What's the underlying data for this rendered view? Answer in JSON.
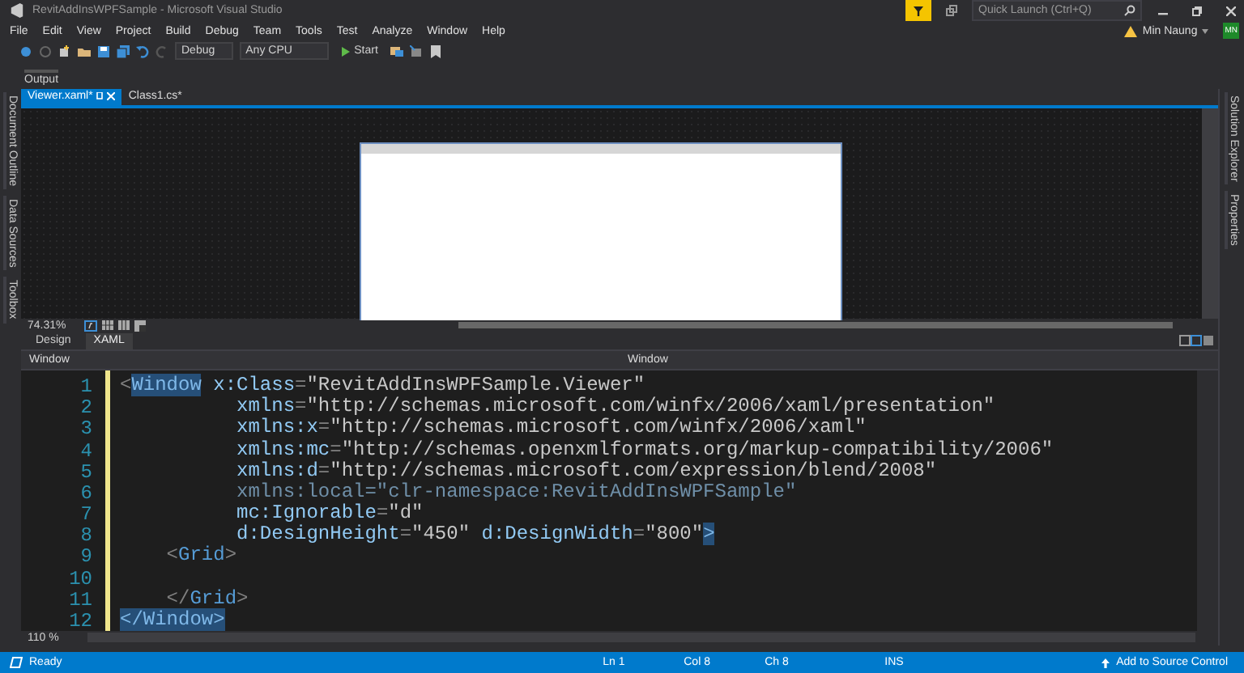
{
  "title_bar": {
    "title": "RevitAddInsWPFSample - Microsoft Visual Studio",
    "quick_launch": {
      "placeholder": "Quick Launch (Ctrl+Q)"
    },
    "user": {
      "name": "Min Naung",
      "initials": "MN"
    }
  },
  "menu": [
    "File",
    "Edit",
    "View",
    "Project",
    "Build",
    "Debug",
    "Team",
    "Tools",
    "Test",
    "Analyze",
    "Window",
    "Help"
  ],
  "toolbar": {
    "configuration": "Debug",
    "platform": "Any CPU",
    "start": "Start"
  },
  "output_panel": {
    "label": "Output"
  },
  "left_tabs": [
    "Document Outline",
    "Data Sources",
    "Toolbox"
  ],
  "right_tabs": [
    "Solution Explorer",
    "Properties"
  ],
  "document_tabs": [
    {
      "label": "Viewer.xaml*",
      "selected": true
    },
    {
      "label": "Class1.cs*",
      "selected": false
    }
  ],
  "designer": {
    "zoom": "74.31%"
  },
  "view_tabs": [
    {
      "label": "Design",
      "selected": false
    },
    {
      "label": "XAML",
      "selected": true
    }
  ],
  "breadcrumbs": [
    "Window",
    "Window"
  ],
  "code": [
    {
      "number": "1",
      "tokens": [
        {
          "t": "<",
          "kind": "punct",
          "highlighted": false
        },
        {
          "t": "Window",
          "kind": "tag",
          "highlighted": true
        },
        {
          "t": " x:Class",
          "kind": "attr",
          "highlighted": false
        },
        {
          "t": "=",
          "kind": "punct",
          "highlighted": false
        },
        {
          "t": "\"RevitAddInsWPFSample.Viewer\"",
          "kind": "value",
          "highlighted": false
        }
      ]
    },
    {
      "number": "2",
      "tokens": [
        {
          "t": "          xmlns",
          "kind": "attr",
          "highlighted": false
        },
        {
          "t": "=",
          "kind": "punct",
          "highlighted": false
        },
        {
          "t": "\"http://schemas.microsoft.com/winfx/2006/xaml/presentation\"",
          "kind": "value",
          "highlighted": false
        }
      ]
    },
    {
      "number": "3",
      "tokens": [
        {
          "t": "          xmlns:x",
          "kind": "attr",
          "highlighted": false
        },
        {
          "t": "=",
          "kind": "punct",
          "highlighted": false
        },
        {
          "t": "\"http://schemas.microsoft.com/winfx/2006/xaml\"",
          "kind": "value",
          "highlighted": false
        }
      ]
    },
    {
      "number": "4",
      "tokens": [
        {
          "t": "          xmlns:mc",
          "kind": "attr",
          "highlighted": false
        },
        {
          "t": "=",
          "kind": "punct",
          "highlighted": false
        },
        {
          "t": "\"http://schemas.openxmlformats.org/markup-compatibility/2006\"",
          "kind": "value",
          "highlighted": false
        }
      ]
    },
    {
      "number": "5",
      "tokens": [
        {
          "t": "          xmlns:d",
          "kind": "attr",
          "highlighted": false
        },
        {
          "t": "=",
          "kind": "punct",
          "highlighted": false
        },
        {
          "t": "\"http://schemas.microsoft.com/expression/blend/2008\"",
          "kind": "value",
          "highlighted": false
        }
      ]
    },
    {
      "number": "6",
      "tokens": [
        {
          "t": "          xmlns:local=\"clr-namespace:RevitAddInsWPFSample\"",
          "kind": "dim",
          "highlighted": false
        }
      ]
    },
    {
      "number": "7",
      "tokens": [
        {
          "t": "          mc:Ignorable",
          "kind": "attr",
          "highlighted": false
        },
        {
          "t": "=",
          "kind": "punct",
          "highlighted": false
        },
        {
          "t": "\"d\"",
          "kind": "value",
          "highlighted": false
        }
      ]
    },
    {
      "number": "8",
      "tokens": [
        {
          "t": "          d:DesignHeight",
          "kind": "attr",
          "highlighted": false
        },
        {
          "t": "=",
          "kind": "punct",
          "highlighted": false
        },
        {
          "t": "\"450\"",
          "kind": "value",
          "highlighted": false
        },
        {
          "t": " d:DesignWidth",
          "kind": "attr",
          "highlighted": false
        },
        {
          "t": "=",
          "kind": "punct",
          "highlighted": false
        },
        {
          "t": "\"800\"",
          "kind": "value",
          "highlighted": false
        },
        {
          "t": ">",
          "kind": "punct",
          "highlighted": true
        }
      ]
    },
    {
      "number": "9",
      "tokens": [
        {
          "t": "    <",
          "kind": "punct",
          "highlighted": false
        },
        {
          "t": "Grid",
          "kind": "tag",
          "highlighted": false
        },
        {
          "t": ">",
          "kind": "punct",
          "highlighted": false
        }
      ]
    },
    {
      "number": "10"
    },
    {
      "number": "11",
      "tokens": [
        {
          "t": "    </",
          "kind": "punct",
          "highlighted": false
        },
        {
          "t": "Grid",
          "kind": "tag",
          "highlighted": false
        },
        {
          "t": ">",
          "kind": "punct",
          "highlighted": false
        }
      ]
    },
    {
      "number": "12",
      "tokens": [
        {
          "t": "</",
          "kind": "punct",
          "highlighted": true
        },
        {
          "t": "Window",
          "kind": "tag",
          "highlighted": true
        },
        {
          "t": ">",
          "kind": "punct",
          "highlighted": true
        }
      ]
    }
  ],
  "editor_zoom": "110 %",
  "status_bar": {
    "message": "Ready",
    "line": "Ln 1",
    "column": "Col 8",
    "char": "Ch 8",
    "mode": "INS",
    "source_control": "Add to Source Control"
  }
}
